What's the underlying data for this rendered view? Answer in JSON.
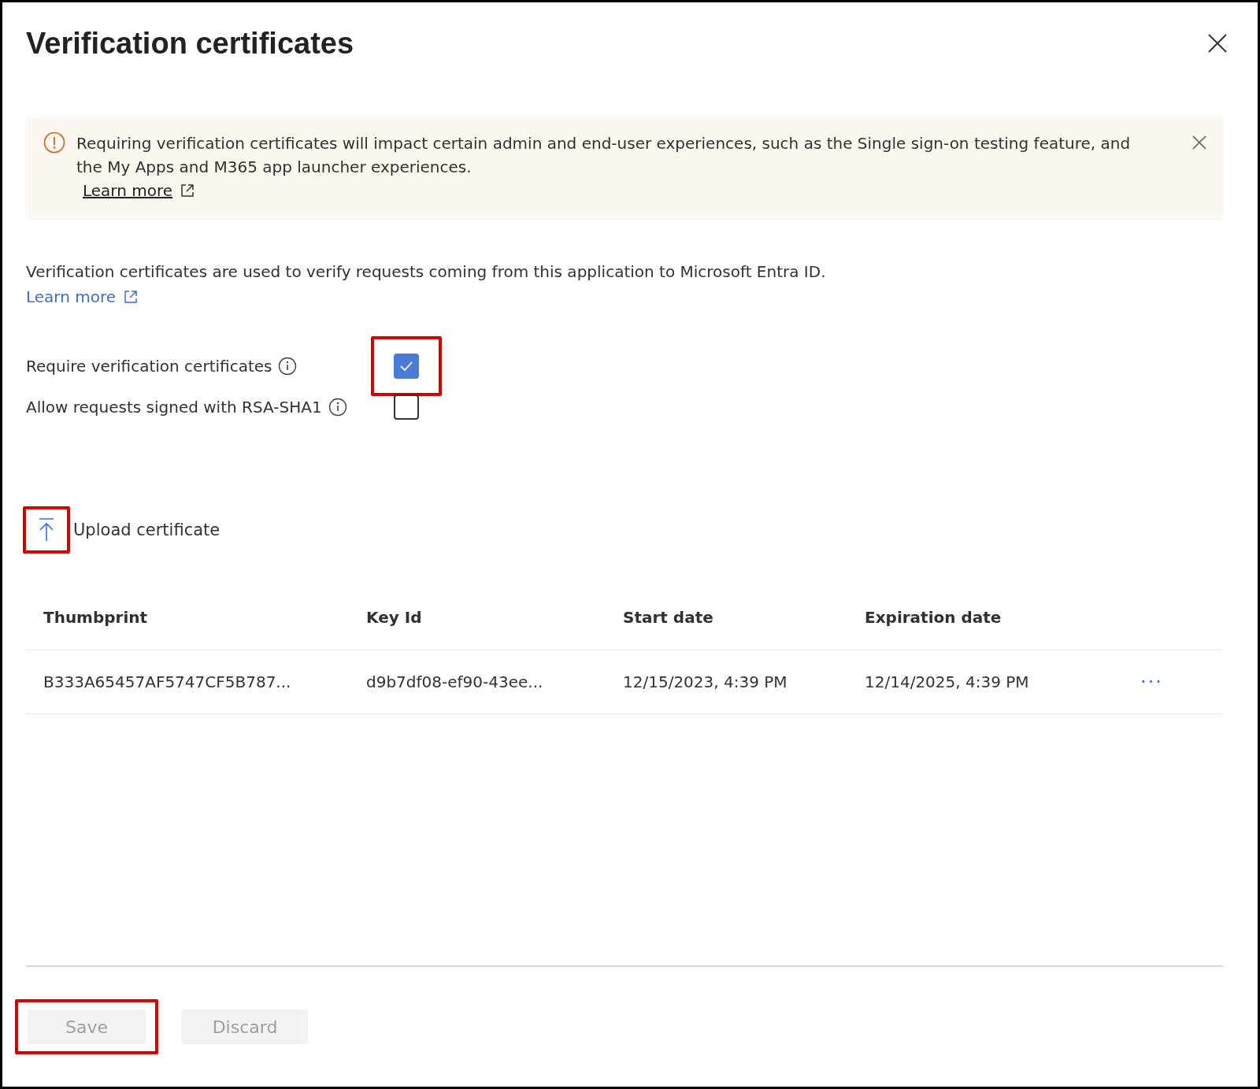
{
  "panel": {
    "title": "Verification certificates"
  },
  "banner": {
    "message": "Requiring verification certificates will impact certain admin and end-user experiences, such as the Single sign-on testing feature, and the My Apps and M365 app launcher experiences.",
    "link": "Learn more"
  },
  "description": {
    "text": "Verification certificates are used to verify requests coming from this application to Microsoft Entra ID.",
    "link": "Learn more"
  },
  "options": [
    {
      "label": "Require verification certificates",
      "checked": true,
      "highlighted": true
    },
    {
      "label": "Allow requests signed with RSA-SHA1",
      "checked": false,
      "highlighted": false
    }
  ],
  "upload": {
    "label": "Upload certificate",
    "highlighted": true
  },
  "table": {
    "columns": [
      "Thumbprint",
      "Key Id",
      "Start date",
      "Expiration date"
    ],
    "rows": [
      {
        "cells": [
          "B333A65457AF5747CF5B787...",
          "d9b7df08-ef90-43ee...",
          "12/15/2023, 4:39 PM",
          "12/14/2025, 4:39 PM"
        ],
        "more": "···"
      }
    ]
  },
  "buttons": [
    {
      "label": "Save",
      "disabled": true,
      "highlighted": true
    },
    {
      "label": "Discard",
      "disabled": true,
      "highlighted": false
    }
  ]
}
